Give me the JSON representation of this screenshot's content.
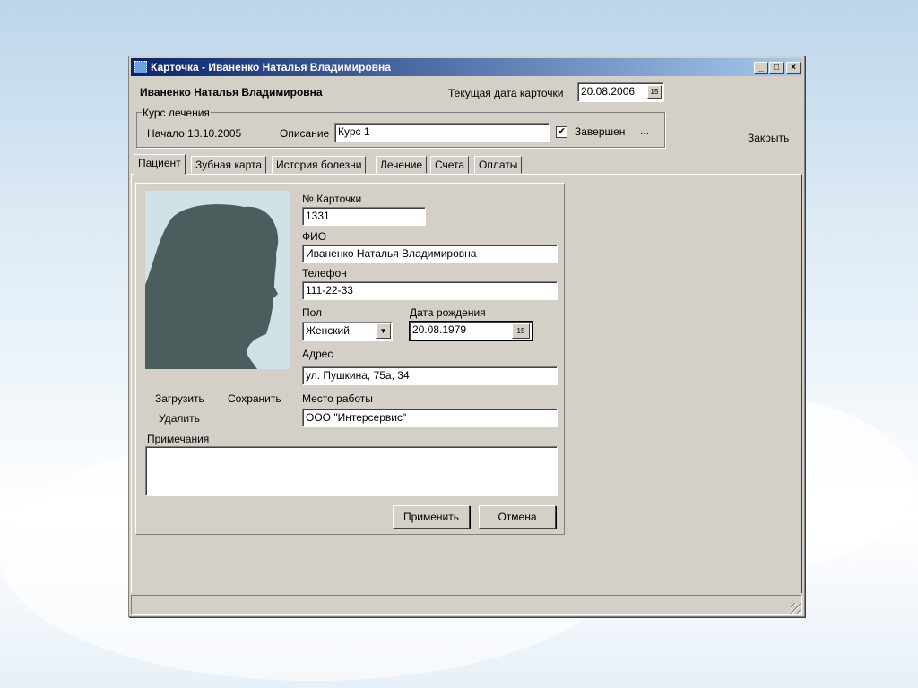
{
  "window": {
    "title": "Карточка - Иваненко Наталья Владимировна",
    "min": "_",
    "max": "□",
    "close": "×"
  },
  "header": {
    "patient_name": "Иваненко Наталья Владимировна",
    "current_date_label": "Текущая дата карточки",
    "current_date": "20.08.2006",
    "calendar_icon": "15",
    "close_label": "Закрыть"
  },
  "course": {
    "group_label": "Курс лечения",
    "start": "Начало 13.10.2005",
    "description_label": "Описание",
    "description": "Курс 1",
    "completed_label": "Завершен",
    "completed": true,
    "more": "..."
  },
  "tabs": [
    "Пациент",
    "Зубная карта",
    "История болезни",
    "Лечение",
    "Счета",
    "Оплаты"
  ],
  "patient": {
    "card_no_label": "№ Карточки",
    "card_no": "1331",
    "fio_label": "ФИО",
    "fio": "Иваненко Наталья Владимировна",
    "phone_label": "Телефон",
    "phone": "111-22-33",
    "sex_label": "Пол",
    "sex": "Женский",
    "birth_label": "Дата рождения",
    "birth": "20.08.1979",
    "calendar_icon": "15",
    "address_label": "Адрес",
    "address": "ул. Пушкина, 75а, 34",
    "work_label": "Место работы",
    "work": "ООО \"Интерсервис\"",
    "notes_label": "Примечания",
    "notes": "",
    "photo_load": "Загрузить",
    "photo_save": "Сохранить",
    "photo_delete": "Удалить",
    "apply": "Применить",
    "cancel": "Отмена"
  }
}
